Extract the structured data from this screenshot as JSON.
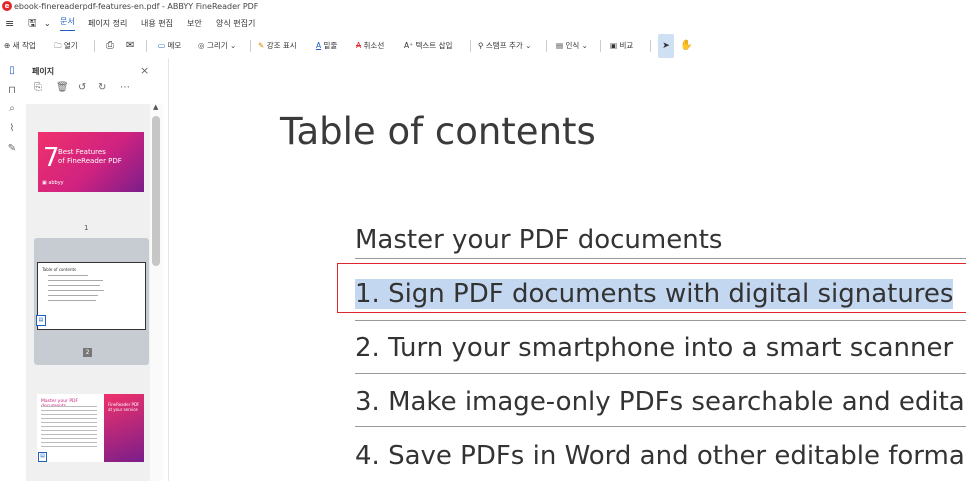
{
  "window": {
    "title": "ebook-finereaderpdf-features-en.pdf - ABBYY FineReader PDF",
    "logo_glyph": "e"
  },
  "menu": {
    "hamburger": "≡",
    "save_glyph": "🖫",
    "save_dropdown": "⌄",
    "items": [
      "문서",
      "페이지 정리",
      "내용 편집",
      "보안",
      "양식 편집기"
    ],
    "active_index": 0
  },
  "toolbar": {
    "new": "⊕ 새 작업",
    "open": "🗀 열기",
    "print": "⎙",
    "email": "✉",
    "memo": "메모",
    "draw": "그리기 ⌄",
    "highlight": "강조 표시",
    "underline": "밑줄",
    "strikeout": "취소선",
    "insert_text": "텍스트 삽입",
    "stamp": "스탬프 추가 ⌄",
    "recognize": "인식 ⌄",
    "compare": "비교",
    "select_tool": "➤",
    "hand_tool": "✋"
  },
  "left_rail": {
    "icons": [
      "page-icon",
      "bookmark-icon",
      "search-icon",
      "attachment-icon",
      "signature-icon"
    ],
    "glyphs": [
      "▯",
      "⊓",
      "⌕",
      "⌇",
      "✎"
    ]
  },
  "pages_panel": {
    "title": "페이지",
    "close": "×",
    "tools": [
      "⎘",
      "🗑",
      "↺",
      "↻",
      "⋯"
    ],
    "scroll_up": "▲",
    "thumbnails": [
      {
        "page": "1",
        "seven": "7",
        "line1": "Best Features",
        "line2": "of FineReader PDF",
        "brand": "▣ abbyy"
      },
      {
        "page": "2",
        "heading": "Table of contents",
        "icon": "▤"
      },
      {
        "heading": "Master your PDF documents",
        "right_line1": "FineReader PDF",
        "right_line2": "at your service",
        "icon": "▤"
      }
    ]
  },
  "document": {
    "title": "Table of contents",
    "toc": [
      "Master your PDF documents",
      "1. Sign PDF documents with digital signatures",
      "2. Turn your smartphone into a smart scanner",
      "3. Make image-only PDFs searchable and edita",
      "4. Save PDFs in Word and other editable forma"
    ],
    "selected_index": 1
  },
  "colors": {
    "accent": "#1f5fbf",
    "selection": "#c4d7f0",
    "highlight_border": "#e0262b"
  }
}
